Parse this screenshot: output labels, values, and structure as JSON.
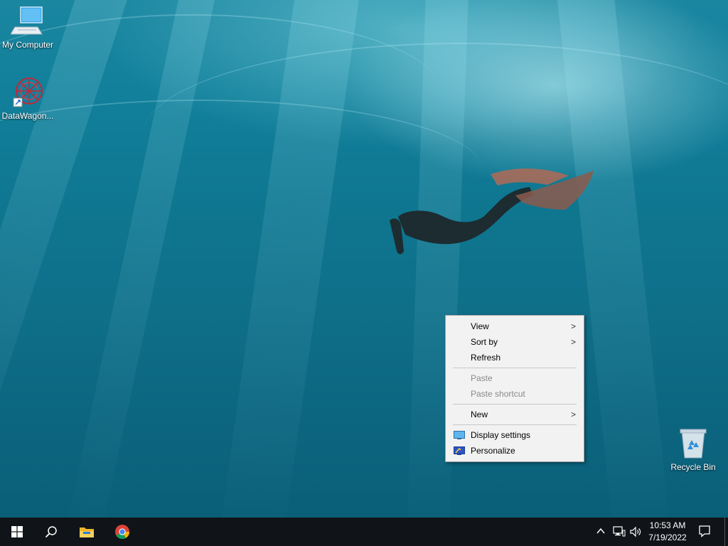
{
  "desktop": {
    "icons": [
      {
        "label": "My Computer",
        "icon": "computer-icon"
      },
      {
        "label": "DataWagon...",
        "icon": "datawagon-app-icon"
      },
      {
        "label": "Recycle Bin",
        "icon": "recycle-bin-icon"
      }
    ]
  },
  "context_menu": {
    "items": [
      {
        "label": "View",
        "submenu": true,
        "enabled": true
      },
      {
        "label": "Sort by",
        "submenu": true,
        "enabled": true
      },
      {
        "label": "Refresh",
        "submenu": false,
        "enabled": true
      },
      {
        "label": "Paste",
        "submenu": false,
        "enabled": false
      },
      {
        "label": "Paste shortcut",
        "submenu": false,
        "enabled": false
      },
      {
        "label": "New",
        "submenu": true,
        "enabled": true
      },
      {
        "label": "Display settings",
        "icon": "display-settings-icon",
        "enabled": true
      },
      {
        "label": "Personalize",
        "icon": "personalize-icon",
        "enabled": true
      }
    ],
    "chevron": ">"
  },
  "taskbar": {
    "icons": [
      "windows-start-icon",
      "search-icon",
      "file-explorer-icon",
      "chrome-icon"
    ],
    "tray": {
      "time": "10:53 AM",
      "date": "7/19/2022",
      "icons": [
        "chevron-up-icon",
        "network-icon",
        "volume-icon",
        "notification-icon"
      ]
    }
  },
  "colors": {
    "taskbar": "#101418",
    "menu_background": "#f2f2f2",
    "menu_disabled_text": "#8a8a8a"
  }
}
